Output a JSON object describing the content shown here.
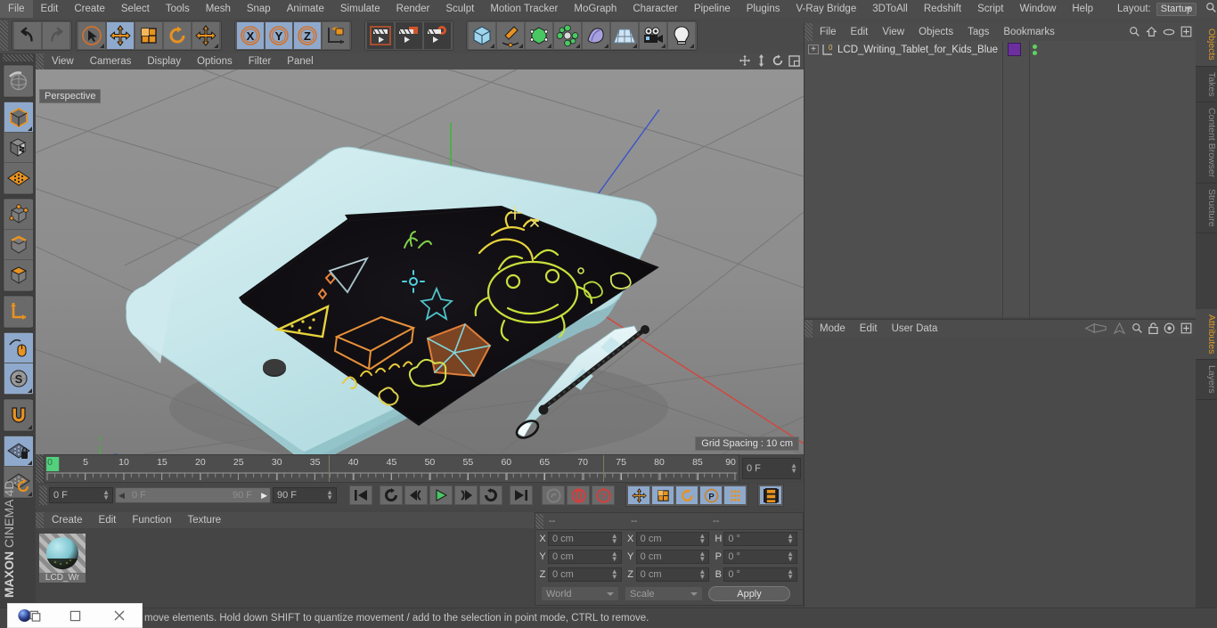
{
  "app": {
    "title": "MAXON CINEMA 4D",
    "brand_line1": "MAXON",
    "brand_line2": "CINEMA 4D"
  },
  "menubar": {
    "items": [
      "File",
      "Edit",
      "Create",
      "Select",
      "Tools",
      "Mesh",
      "Snap",
      "Animate",
      "Simulate",
      "Render",
      "Sculpt",
      "Motion Tracker",
      "MoGraph",
      "Character",
      "Pipeline",
      "Plugins",
      "V-Ray Bridge",
      "3DToAll",
      "Redshift",
      "Script",
      "Window",
      "Help"
    ],
    "layout_label": "Layout:",
    "layout_value": "Startup",
    "search_icon": "search-icon"
  },
  "toolbar": {
    "groups": [
      {
        "name": "undo-redo",
        "buttons": [
          {
            "name": "undo-button",
            "icon": "undo-arrow-icon",
            "active": false
          },
          {
            "name": "redo-button",
            "icon": "redo-arrow-icon",
            "active": false,
            "disabled": true
          }
        ]
      },
      {
        "name": "transform-tools",
        "buttons": [
          {
            "name": "live-selection-button",
            "icon": "cursor-circle-icon",
            "active": false
          },
          {
            "name": "move-button",
            "icon": "move-arrows-icon",
            "active": true
          },
          {
            "name": "scale-button",
            "icon": "scale-box-icon",
            "active": false
          },
          {
            "name": "rotate-button",
            "icon": "rotate-arc-icon",
            "active": false
          },
          {
            "name": "move-alt-button",
            "icon": "move-arrows-icon",
            "active": false
          }
        ]
      },
      {
        "name": "axis-locks",
        "buttons": [
          {
            "name": "x-axis-lock-button",
            "icon": "x-axis-icon",
            "label": "X",
            "active": true
          },
          {
            "name": "y-axis-lock-button",
            "icon": "y-axis-icon",
            "label": "Y",
            "active": true
          },
          {
            "name": "z-axis-lock-button",
            "icon": "z-axis-icon",
            "label": "Z",
            "active": true
          },
          {
            "name": "world-object-coord-button",
            "icon": "world-axis-cube-icon",
            "active": false
          }
        ]
      },
      {
        "name": "render-tools",
        "buttons": [
          {
            "name": "render-view-button",
            "icon": "render-clapper-icon",
            "active": false
          },
          {
            "name": "render-to-picture-viewer-button",
            "icon": "render-picture-icon",
            "active": false
          },
          {
            "name": "render-settings-button",
            "icon": "render-gear-icon",
            "active": false
          }
        ]
      },
      {
        "name": "create-objects",
        "buttons": [
          {
            "name": "add-cube-button",
            "icon": "blue-cube-icon",
            "active": false
          },
          {
            "name": "add-spline-button",
            "icon": "pen-spline-icon",
            "active": false
          },
          {
            "name": "add-generator-button",
            "icon": "green-cube-icon",
            "active": false
          },
          {
            "name": "add-mograph-button",
            "icon": "green-cluster-icon",
            "active": false
          },
          {
            "name": "add-deformer-button",
            "icon": "purple-bend-icon",
            "active": false
          },
          {
            "name": "add-scene-button",
            "icon": "floor-grid-icon",
            "active": false
          },
          {
            "name": "add-camera-button",
            "icon": "camera-icon",
            "active": false
          },
          {
            "name": "add-light-button",
            "icon": "lightbulb-icon",
            "active": false
          }
        ]
      }
    ]
  },
  "leftbar": {
    "groups": [
      {
        "name": "undo-view-group",
        "buttons": [
          {
            "name": "undo-view-button",
            "icon": "globe-sphere-icon",
            "active": false
          }
        ]
      },
      {
        "name": "editor-mode-group",
        "buttons": [
          {
            "name": "make-editable-button",
            "icon": "editable-cube-icon",
            "active": true
          },
          {
            "name": "texture-axis-button",
            "icon": "checker-cube-icon",
            "active": false
          },
          {
            "name": "viewport-solo-button",
            "icon": "orange-grid-icon",
            "active": false
          }
        ]
      },
      {
        "name": "component-mode-group",
        "buttons": [
          {
            "name": "points-mode-button",
            "icon": "points-cube-icon",
            "active": false
          },
          {
            "name": "edges-mode-button",
            "icon": "edges-cube-icon",
            "active": false
          },
          {
            "name": "polygons-mode-button",
            "icon": "polygons-cube-icon",
            "active": false
          }
        ]
      },
      {
        "name": "axis-group",
        "buttons": [
          {
            "name": "enable-axis-button",
            "icon": "axis-l-icon",
            "active": false
          }
        ]
      },
      {
        "name": "snap-group",
        "buttons": [
          {
            "name": "workplane-button",
            "icon": "workplane-mouse-icon",
            "active": true
          },
          {
            "name": "soft-selection-button",
            "icon": "s-circle-icon",
            "active": true
          }
        ]
      },
      {
        "name": "magnet-group",
        "buttons": [
          {
            "name": "magnet-button",
            "icon": "magnet-icon",
            "active": false
          }
        ]
      },
      {
        "name": "lock-group",
        "buttons": [
          {
            "name": "lock-workplane-button",
            "icon": "grid-lock-icon",
            "active": true
          },
          {
            "name": "planar-workplane-button",
            "icon": "grid-rotate-icon",
            "active": false
          }
        ]
      }
    ]
  },
  "viewport": {
    "menu_items": [
      "View",
      "Cameras",
      "Display",
      "Options",
      "Filter",
      "Panel"
    ],
    "label": "Perspective",
    "grid_spacing": "Grid Spacing : 10 cm",
    "nav_icons": [
      "pan-icon",
      "dolly-icon",
      "rotate-icon",
      "maximize-icon"
    ],
    "axis_colors": {
      "x": "#d4463c",
      "y": "#43b23e",
      "z": "#3a55c7"
    },
    "background": "#8a8a8a",
    "model": {
      "name": "LCD Writing Tablet for Kids (Blue)",
      "body_color": "#bfe3e6",
      "screen_color": "#0c0a0a"
    }
  },
  "timeline": {
    "ticks": [
      "0",
      "5",
      "10",
      "15",
      "20",
      "25",
      "30",
      "35",
      "40",
      "45",
      "50",
      "55",
      "60",
      "65",
      "70",
      "75",
      "80",
      "85",
      "90"
    ],
    "min_frame": 0,
    "max_frame": 90,
    "current_frame": "0 F",
    "range_start": "0 F",
    "range_end": "90 F",
    "end_field": "90 F",
    "right_field": "0 F",
    "playhead_color": "#52d07c"
  },
  "transport": {
    "current_frame_field": "0 F",
    "range_start_field": "0 F",
    "range_end_field": "90 F",
    "preview_end_field": "90 F",
    "buttons": [
      {
        "name": "go-to-start-button",
        "icon": "skip-start-icon"
      },
      {
        "name": "play-reverse-loop-button",
        "icon": "loop-reverse-icon"
      },
      {
        "name": "step-back-button",
        "icon": "step-back-icon"
      },
      {
        "name": "play-button",
        "icon": "play-icon"
      },
      {
        "name": "step-forward-button",
        "icon": "step-forward-icon"
      },
      {
        "name": "play-forward-loop-button",
        "icon": "loop-forward-icon"
      },
      {
        "name": "go-to-end-button",
        "icon": "skip-end-icon"
      },
      {
        "name": "record-active-objects-button",
        "icon": "key-disabled-icon"
      },
      {
        "name": "autokeying-button",
        "icon": "record-red-icon"
      },
      {
        "name": "keyframe-selection-button",
        "icon": "question-red-icon"
      },
      {
        "name": "position-key-button",
        "icon": "move-key-icon",
        "active": true
      },
      {
        "name": "scale-key-button",
        "icon": "scale-key-icon",
        "active": true
      },
      {
        "name": "rotation-key-button",
        "icon": "rotate-key-icon",
        "active": true
      },
      {
        "name": "parameter-key-button",
        "icon": "param-p-icon",
        "active": true
      },
      {
        "name": "point-level-animation-button",
        "icon": "pla-dots-icon",
        "active": true
      },
      {
        "name": "timeline-toggle-button",
        "icon": "filmstrip-icon",
        "active": true
      }
    ]
  },
  "material_manager": {
    "menu_items": [
      "Create",
      "Edit",
      "Function",
      "Texture"
    ],
    "materials": [
      {
        "name": "LCD_Wr",
        "sphere_color": "#8fd3da"
      }
    ]
  },
  "coordinates": {
    "headers": [
      "--",
      "--",
      "--"
    ],
    "rows": [
      {
        "label_pos": "X",
        "value_pos": "0 cm",
        "label_size": "X",
        "value_size": "0 cm",
        "label_rot": "H",
        "value_rot": "0 °"
      },
      {
        "label_pos": "Y",
        "value_pos": "0 cm",
        "label_size": "Y",
        "value_size": "0 cm",
        "label_rot": "P",
        "value_rot": "0 °"
      },
      {
        "label_pos": "Z",
        "value_pos": "0 cm",
        "label_size": "Z",
        "value_size": "0 cm",
        "label_rot": "B",
        "value_rot": "0 °"
      }
    ],
    "coord_system": "World",
    "size_mode": "Scale",
    "apply_label": "Apply"
  },
  "object_manager": {
    "menu_items": [
      "File",
      "Edit",
      "View",
      "Objects",
      "Tags",
      "Bookmarks"
    ],
    "icons": [
      "search-icon",
      "home-icon",
      "ellipse-icon",
      "expand-icon"
    ],
    "objects": [
      {
        "name": "LCD_Writing_Tablet_for_Kids_Blue",
        "expand": "+",
        "layer_badge": "0",
        "tag_color": "#6b2f9e",
        "dots_color": "#5fd35f"
      }
    ]
  },
  "attribute_manager": {
    "menu_items": [
      "Mode",
      "Edit",
      "User Data"
    ],
    "icons": [
      "prev-icon",
      "next-icon",
      "search-icon",
      "lock-icon",
      "target-icon",
      "expand-icon"
    ]
  },
  "right_tabs": {
    "top": [
      {
        "label": "Objects",
        "active": true
      },
      {
        "label": "Takes",
        "active": false
      },
      {
        "label": "Content Browser",
        "active": false
      },
      {
        "label": "Structure",
        "active": false
      }
    ],
    "bottom": [
      {
        "label": "Attributes",
        "active": true
      },
      {
        "label": "Layers",
        "active": false
      }
    ]
  },
  "statusbar": {
    "message": "move elements. Hold down SHIFT to quantize movement / add to the selection in point mode, CTRL to remove."
  },
  "window_overlay": {
    "app_icon": "cinema4d-orb-icon",
    "restore_icon": "restore-window-icon",
    "close_icon": "close-window-icon"
  }
}
